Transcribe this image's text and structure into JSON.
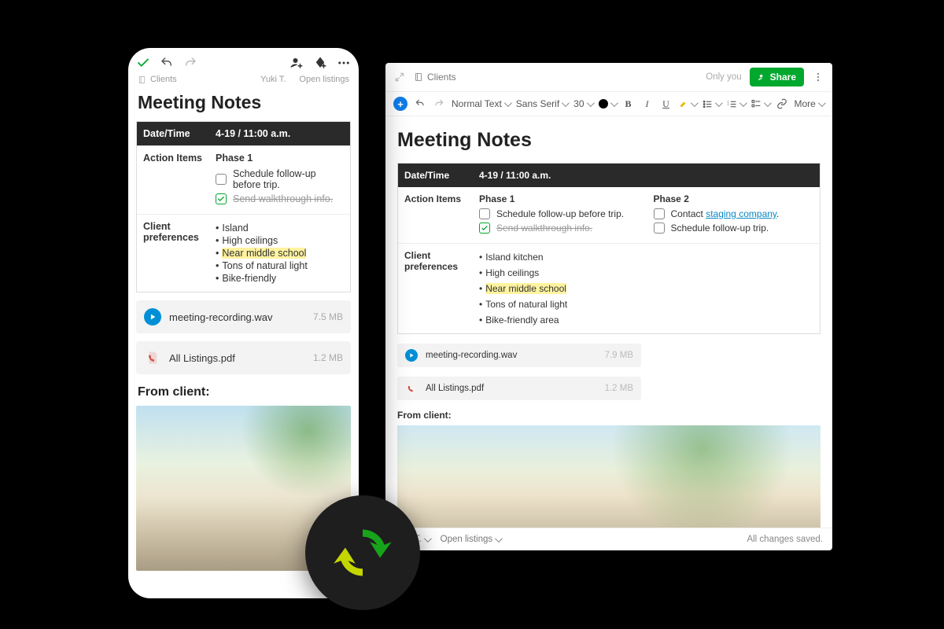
{
  "note_title": "Meeting Notes",
  "mobile": {
    "breadcrumb": "Clients",
    "user": "Yuki T.",
    "tag": "Open listings",
    "table": {
      "datetime_label": "Date/Time",
      "datetime_value": "4-19 / 11:00 a.m.",
      "action_label": "Action Items",
      "phase1_label": "Phase 1",
      "task1": "Schedule follow-up before trip.",
      "task2": "Send walkthrough info.",
      "pref_label": "Client preferences",
      "bullets": [
        "Island",
        "High ceilings",
        "Near middle school",
        "Tons of natural light",
        "Bike-friendly"
      ]
    },
    "attach1_name": "meeting-recording.wav",
    "attach1_size": "7.5 MB",
    "attach2_name": "All Listings.pdf",
    "attach2_size": "1.2 MB",
    "from_client": "From client:"
  },
  "desktop": {
    "breadcrumb": "Clients",
    "only_you": "Only you",
    "share": "Share",
    "toolbar": {
      "style": "Normal Text",
      "font": "Sans Serif",
      "size": "30",
      "more": "More"
    },
    "table": {
      "datetime_label": "Date/Time",
      "datetime_value": "4-19 / 11:00 a.m.",
      "action_label": "Action Items",
      "phase1_label": "Phase 1",
      "p1_task1": "Schedule follow-up before trip.",
      "p1_task2": "Send walkthrough info.",
      "phase2_label": "Phase 2",
      "p2_task1_pre": "Contact ",
      "p2_task1_link": "staging company",
      "p2_task1_post": ".",
      "p2_task2": "Schedule follow-up trip.",
      "pref_label": "Client preferences",
      "bullets": [
        "Island kitchen",
        "High ceilings",
        "Near middle school",
        "Tons of natural light",
        "Bike-friendly area"
      ]
    },
    "attach1_name": "meeting-recording.wav",
    "attach1_size": "7.9 MB",
    "attach2_name": "All Listings.pdf",
    "attach2_size": "1.2 MB",
    "from_client": "From client:",
    "footer_user": "Yuki T.",
    "footer_tag": "Open listings",
    "saved": "All changes saved."
  }
}
